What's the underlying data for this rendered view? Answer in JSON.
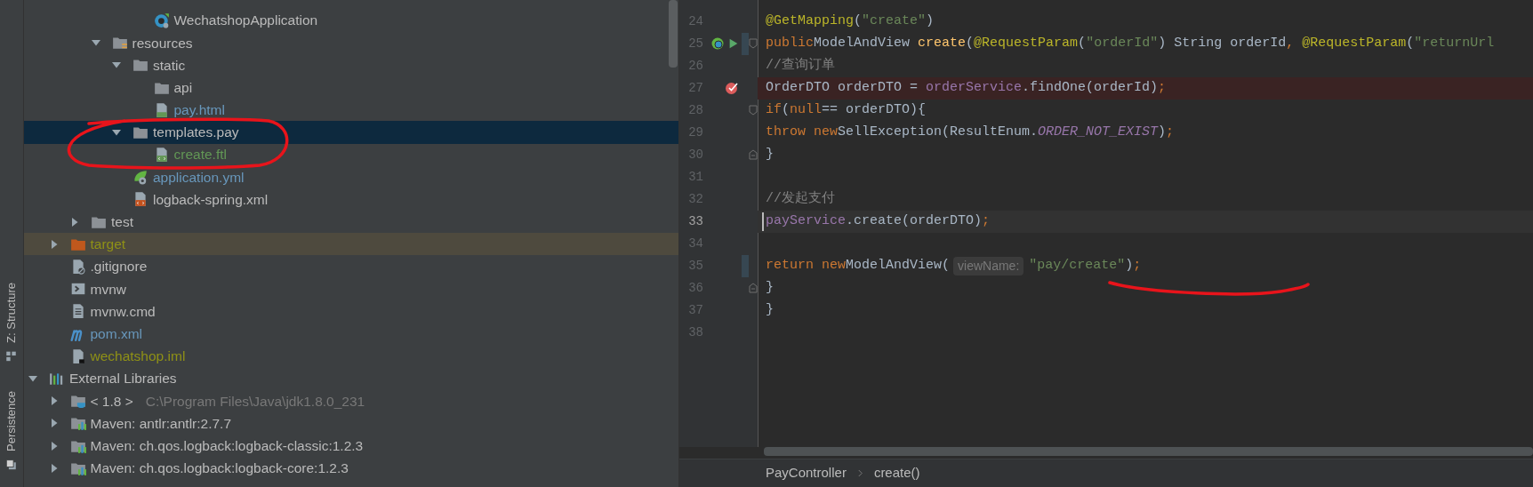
{
  "tool_strip": [
    {
      "label": "Z: Structure",
      "kind": "structure"
    },
    {
      "label": "Persistence",
      "kind": "persistence"
    }
  ],
  "tree": [
    {
      "children": [
        {
          "children": [
            {
              "children": [
                {
                  "children": [
                    {
                      "children": [
                        {
                          "label": "WechatshopApplication",
                          "kind": "spring-class",
                          "selected": false
                        }
                      ]
                    }
                  ]
                },
                {
                  "label": "resources",
                  "kind": "resources-folder",
                  "expanded": true,
                  "selected": false,
                  "children": [
                    {
                      "label": "static",
                      "kind": "folder",
                      "expanded": true,
                      "selected": false,
                      "children": [
                        {
                          "label": "api",
                          "kind": "folder",
                          "selected": false
                        },
                        {
                          "label": "pay.html",
                          "kind": "html",
                          "color": "#6897bb",
                          "selected": false
                        }
                      ]
                    },
                    {
                      "label": "templates.pay",
                      "kind": "folder",
                      "expanded": true,
                      "selected": true,
                      "children": [
                        {
                          "label": "create.ftl",
                          "kind": "ftl",
                          "color": "#629755",
                          "selected": false
                        }
                      ]
                    },
                    {
                      "label": "application.yml",
                      "kind": "yml",
                      "color": "#6897bb",
                      "selected": false
                    },
                    {
                      "label": "logback-spring.xml",
                      "kind": "xml",
                      "selected": false
                    }
                  ]
                }
              ]
            },
            {
              "label": "test",
              "kind": "folder",
              "expanded": false,
              "selected": false
            }
          ]
        },
        {
          "label": "target",
          "kind": "excluded-folder",
          "color": "#8f9116",
          "expanded": false,
          "selected": false
        },
        {
          "label": ".gitignore",
          "kind": "gitignore",
          "selected": false
        },
        {
          "label": "mvnw",
          "kind": "shell",
          "selected": false
        },
        {
          "label": "mvnw.cmd",
          "kind": "text",
          "selected": false
        },
        {
          "label": "pom.xml",
          "kind": "maven",
          "color": "#6897bb",
          "selected": false
        },
        {
          "label": "wechatshop.iml",
          "kind": "iml",
          "color": "#8f9116",
          "selected": false
        }
      ]
    },
    {
      "label": "External Libraries",
      "kind": "libraries",
      "expanded": true,
      "selected": false,
      "children": [
        {
          "label": "< 1.8 >",
          "hint": "C:\\Program Files\\Java\\jdk1.8.0_231",
          "kind": "jdk",
          "expanded": false,
          "selected": false
        },
        {
          "label": "Maven: antlr:antlr:2.7.7",
          "kind": "library",
          "expanded": false,
          "selected": false
        },
        {
          "label": "Maven: ch.qos.logback:logback-classic:1.2.3",
          "kind": "library",
          "expanded": false,
          "selected": false
        },
        {
          "label": "Maven: ch.qos.logback:logback-core:1.2.3",
          "kind": "library",
          "expanded": false,
          "selected": false
        }
      ]
    }
  ],
  "editor": {
    "lines": [
      {
        "number": "24",
        "kind": "normal",
        "tokens": [
          {
            "text": "    @GetMapping",
            "kind": "annotation"
          },
          {
            "text": "(",
            "kind": "plain"
          },
          {
            "text": "\"create\"",
            "kind": "string"
          },
          {
            "text": ")",
            "kind": "plain"
          }
        ]
      },
      {
        "number": "25",
        "kind": "normal",
        "marks": [
          {
            "kind": "bean"
          },
          {
            "kind": "run"
          },
          {
            "kind": "change"
          },
          {
            "kind": "fold-start"
          }
        ],
        "tokens": [
          {
            "text": "    public",
            "kind": "keyword"
          },
          {
            "text": " ModelAndView ",
            "kind": "plain"
          },
          {
            "text": "create",
            "kind": "declaration"
          },
          {
            "text": "(",
            "kind": "plain"
          },
          {
            "text": "@RequestParam",
            "kind": "annotation"
          },
          {
            "text": "(",
            "kind": "plain"
          },
          {
            "text": "\"orderId\"",
            "kind": "string"
          },
          {
            "text": ") String orderId",
            "kind": "plain"
          },
          {
            "text": ", ",
            "kind": "punctuation"
          },
          {
            "text": "@RequestParam",
            "kind": "annotation"
          },
          {
            "text": "(",
            "kind": "plain"
          },
          {
            "text": "\"returnUrl",
            "kind": "string"
          }
        ]
      },
      {
        "number": "26",
        "kind": "normal",
        "tokens": [
          {
            "text": "        //查询订单",
            "kind": "comment"
          }
        ]
      },
      {
        "number": "27",
        "kind": "breakpoint",
        "marks": [
          {
            "kind": "breakpoint"
          }
        ],
        "tokens": [
          {
            "text": "        OrderDTO orderDTO = ",
            "kind": "plain"
          },
          {
            "text": "orderService",
            "kind": "field"
          },
          {
            "text": ".findOne(orderId)",
            "kind": "plain"
          },
          {
            "text": ";",
            "kind": "punctuation"
          }
        ]
      },
      {
        "number": "28",
        "kind": "normal",
        "marks": [
          {
            "kind": "fold-start"
          }
        ],
        "tokens": [
          {
            "text": "        if",
            "kind": "keyword"
          },
          {
            "text": "(",
            "kind": "plain"
          },
          {
            "text": "null",
            "kind": "keyword"
          },
          {
            "text": " == orderDTO){",
            "kind": "plain"
          }
        ]
      },
      {
        "number": "29",
        "kind": "normal",
        "tokens": [
          {
            "text": "            throw new",
            "kind": "keyword"
          },
          {
            "text": " SellException(ResultEnum.",
            "kind": "plain"
          },
          {
            "text": "ORDER_NOT_EXIST",
            "kind": "constant"
          },
          {
            "text": ")",
            "kind": "plain"
          },
          {
            "text": ";",
            "kind": "punctuation"
          }
        ]
      },
      {
        "number": "30",
        "kind": "normal",
        "marks": [
          {
            "kind": "fold-end"
          }
        ],
        "tokens": [
          {
            "text": "        }",
            "kind": "plain"
          }
        ]
      },
      {
        "number": "31",
        "kind": "normal"
      },
      {
        "number": "32",
        "kind": "normal",
        "tokens": [
          {
            "text": "        //发起支付",
            "kind": "comment"
          }
        ]
      },
      {
        "number": "33",
        "kind": "current",
        "tokens": [
          {
            "text": "        payService",
            "kind": "field"
          },
          {
            "text": ".create(orderDTO)",
            "kind": "plain"
          },
          {
            "text": ";",
            "kind": "punctuation"
          }
        ]
      },
      {
        "number": "34",
        "kind": "normal"
      },
      {
        "number": "35",
        "kind": "normal",
        "marks": [
          {
            "kind": "change"
          }
        ],
        "tokens": [
          {
            "text": "        return new",
            "kind": "keyword"
          },
          {
            "text": " ModelAndView(",
            "kind": "plain"
          },
          {
            "text": "viewName:",
            "kind": "hint"
          },
          {
            "text": "\"pay/create\"",
            "kind": "string"
          },
          {
            "text": ")",
            "kind": "plain"
          },
          {
            "text": ";",
            "kind": "punctuation"
          }
        ]
      },
      {
        "number": "36",
        "kind": "normal",
        "marks": [
          {
            "kind": "fold-end"
          }
        ],
        "tokens": [
          {
            "text": "    }",
            "kind": "plain"
          }
        ]
      },
      {
        "number": "37",
        "kind": "normal",
        "tokens": [
          {
            "text": "}",
            "kind": "plain"
          }
        ]
      },
      {
        "number": "38",
        "kind": "normal"
      }
    ]
  },
  "breadcrumbs": [
    "PayController",
    "create()"
  ]
}
